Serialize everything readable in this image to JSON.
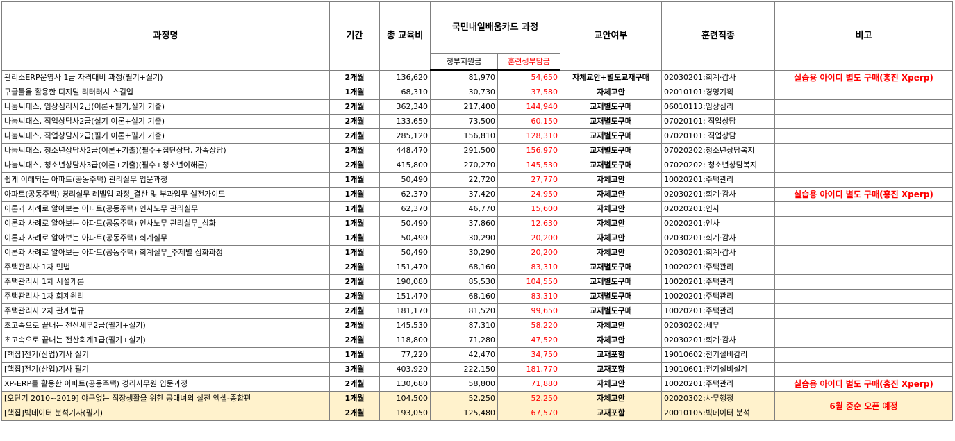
{
  "header": {
    "course_name": "과정명",
    "period": "기간",
    "total_fee": "총 교육비",
    "card_course": "국민내일배움카드 과정",
    "gov_support": "정부지원금",
    "trainee_cost": "훈련생부담금",
    "textbook": "교안여부",
    "job_type": "훈련직종",
    "note": "비고"
  },
  "rows": [
    {
      "name": "관리소ERP운영사 1급 자격대비 과정(필기+실기)",
      "period": "2개월",
      "total": "136,620",
      "gov": "81,970",
      "trainee": "54,650",
      "material": "자체교안+별도교재구매",
      "job": "02030201:회계·감사",
      "note": "실습용 아이디 별도 구매(홍진 Xperp)"
    },
    {
      "name": "구글툴을 활용한 디지털 리터러시 스킬업",
      "period": "1개월",
      "total": "68,310",
      "gov": "30,730",
      "trainee": "37,580",
      "material": "자체교안",
      "job": "02010101:경영기획",
      "note": ""
    },
    {
      "name": "나눔씨패스, 임상심리사2급(이론+필기,실기 기출)",
      "period": "2개월",
      "total": "362,340",
      "gov": "217,400",
      "trainee": "144,940",
      "material": "교재별도구매",
      "job": "06010113:임상심리",
      "note": ""
    },
    {
      "name": "나눔씨패스, 직업상담사2급(실기 이론+실기 기출)",
      "period": "2개월",
      "total": "133,650",
      "gov": "73,500",
      "trainee": "60,150",
      "material": "교재별도구매",
      "job": "07020101: 직업상담",
      "note": ""
    },
    {
      "name": "나눔씨패스, 직업상담사2급(필기 이론+필기 기출)",
      "period": "2개월",
      "total": "285,120",
      "gov": "156,810",
      "trainee": "128,310",
      "material": "교재별도구매",
      "job": "07020101: 직업상담",
      "note": ""
    },
    {
      "name": "나눔씨패스, 청소년상담사2급(이론+기출)(필수+집단상담, 가족상담)",
      "period": "2개월",
      "total": "448,470",
      "gov": "291,500",
      "trainee": "156,970",
      "material": "교재별도구매",
      "job": "07020202:청소년상담복지",
      "note": ""
    },
    {
      "name": "나눔씨패스, 청소년상담사3급(이론+기출)(필수+청소년이해론)",
      "period": "2개월",
      "total": "415,800",
      "gov": "270,270",
      "trainee": "145,530",
      "material": "교재별도구매",
      "job": "07020202: 청소년상담복지",
      "note": ""
    },
    {
      "name": "쉽게 이해되는 아파트(공동주택) 관리실무 입문과정",
      "period": "1개월",
      "total": "50,490",
      "gov": "22,720",
      "trainee": "27,770",
      "material": "자체교안",
      "job": "10020201:주택관리",
      "note": ""
    },
    {
      "name": "아파트(공동주택) 경리실무 레벨업 과정_결산 및 부과업무 실전가이드",
      "period": "1개월",
      "total": "62,370",
      "gov": "37,420",
      "trainee": "24,950",
      "material": "자체교안",
      "job": "02030201:회계·감사",
      "note": "실습용 아이디 별도 구매(홍진 Xperp)"
    },
    {
      "name": "이론과 사례로 알아보는 아파트(공동주택) 인사노무 관리실무",
      "period": "1개월",
      "total": "62,370",
      "gov": "46,770",
      "trainee": "15,600",
      "material": "자체교안",
      "job": "02020201:인사",
      "note": ""
    },
    {
      "name": "이론과 사례로 알아보는 아파트(공동주택) 인사노무 관리실무_심화",
      "period": "1개월",
      "total": "50,490",
      "gov": "37,860",
      "trainee": "12,630",
      "material": "자체교안",
      "job": "02020201:인사",
      "note": ""
    },
    {
      "name": "이론과 사례로 알아보는 아파트(공동주택) 회계실무",
      "period": "1개월",
      "total": "50,490",
      "gov": "30,290",
      "trainee": "20,200",
      "material": "자체교안",
      "job": "02030201:회계·감사",
      "note": ""
    },
    {
      "name": "이론과 사례로 알아보는 아파트(공동주택) 회계실무_주제별 심화과정",
      "period": "1개월",
      "total": "50,490",
      "gov": "30,290",
      "trainee": "20,200",
      "material": "자체교안",
      "job": "02030201:회계·감사",
      "note": ""
    },
    {
      "name": "주택관리사 1차 민법",
      "period": "2개월",
      "total": "151,470",
      "gov": "68,160",
      "trainee": "83,310",
      "material": "교재별도구매",
      "job": "10020201:주택관리",
      "note": ""
    },
    {
      "name": "주택관리사 1차 시설개론",
      "period": "2개월",
      "total": "190,080",
      "gov": "85,530",
      "trainee": "104,550",
      "material": "교재별도구매",
      "job": "10020201:주택관리",
      "note": ""
    },
    {
      "name": "주택관리사 1차 회계원리",
      "period": "2개월",
      "total": "151,470",
      "gov": "68,160",
      "trainee": "83,310",
      "material": "교재별도구매",
      "job": "10020201:주택관리",
      "note": ""
    },
    {
      "name": "주택관리사 2차 관계법규",
      "period": "2개월",
      "total": "181,170",
      "gov": "81,520",
      "trainee": "99,650",
      "material": "교재별도구매",
      "job": "10020201:주택관리",
      "note": ""
    },
    {
      "name": "초고속으로 끝내는 전산세무2급(필기+실기)",
      "period": "2개월",
      "total": "145,530",
      "gov": "87,310",
      "trainee": "58,220",
      "material": "자체교안",
      "job": "02030202:세무",
      "note": ""
    },
    {
      "name": "초고속으로 끝내는 전산회계1급(필기+실기)",
      "period": "2개월",
      "total": "118,800",
      "gov": "71,280",
      "trainee": "47,520",
      "material": "자체교안",
      "job": "02030201:회계·감사",
      "note": ""
    },
    {
      "name": "[핵집]전기(산업)기사 실기",
      "period": "1개월",
      "total": "77,220",
      "gov": "42,470",
      "trainee": "34,750",
      "material": "교재포함",
      "job": "19010602:전기설비감리",
      "note": ""
    },
    {
      "name": "[핵집]전기(산업)기사 필기",
      "period": "3개월",
      "total": "403,920",
      "gov": "222,150",
      "trainee": "181,770",
      "material": "교재포함",
      "job": "19010601:전기설비설계",
      "note": ""
    },
    {
      "name": "XP-ERP를 활용한 아파트(공동주택) 경리사무원 입문과정",
      "period": "2개월",
      "total": "130,680",
      "gov": "58,800",
      "trainee": "71,880",
      "material": "자체교안",
      "job": "10020201:주택관리",
      "note": "실습용 아이디 별도 구매(홍진 Xperp)"
    }
  ],
  "highlight_rows": [
    {
      "name": "[오단기 2010~2019] 야근없는 직장생활을 위한 공대녀의 실전 엑셀-종합편",
      "period": "1개월",
      "total": "104,500",
      "gov": "52,250",
      "trainee": "52,250",
      "material": "자체교안",
      "job": "02020302:사무행정"
    },
    {
      "name": "[핵집]빅데이터 분석기사(필기)",
      "period": "2개월",
      "total": "193,050",
      "gov": "125,480",
      "trainee": "67,570",
      "material": "교재포함",
      "job": "20010105:빅데이터 분석"
    }
  ],
  "highlight_note": "6월 중순 오픈 예정"
}
